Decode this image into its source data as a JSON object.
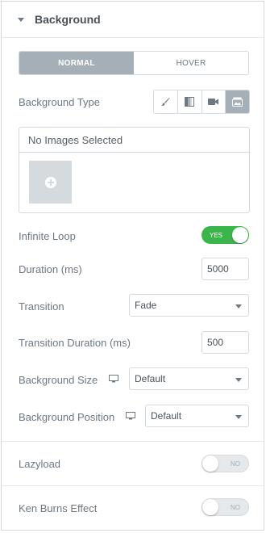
{
  "section": {
    "title": "Background"
  },
  "tabs": [
    {
      "label": "Normal",
      "active": true
    },
    {
      "label": "Hover",
      "active": false
    }
  ],
  "background_type": {
    "label": "Background Type",
    "options": [
      {
        "icon": "brush-icon"
      },
      {
        "icon": "gradient-icon"
      },
      {
        "icon": "video-icon"
      },
      {
        "icon": "slideshow-icon",
        "active": true
      }
    ]
  },
  "gallery": {
    "empty_text": "No Images Selected"
  },
  "infinite_loop": {
    "label": "Infinite Loop",
    "state": "YES"
  },
  "duration": {
    "label": "Duration (ms)",
    "value": "5000"
  },
  "transition": {
    "label": "Transition",
    "value": "Fade"
  },
  "transition_duration": {
    "label": "Transition Duration (ms)",
    "value": "500"
  },
  "background_size": {
    "label": "Background Size",
    "value": "Default"
  },
  "background_position": {
    "label": "Background Position",
    "value": "Default"
  },
  "lazyload": {
    "label": "Lazyload",
    "state": "NO"
  },
  "ken_burns": {
    "label": "Ken Burns Effect",
    "state": "NO"
  },
  "colors": {
    "accent_on": "#39b54a",
    "tab_active": "#a4afb7",
    "border": "#d5d8dc"
  }
}
